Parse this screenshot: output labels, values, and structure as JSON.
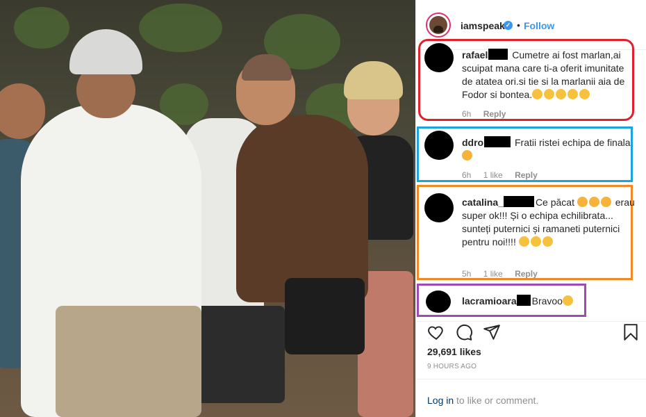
{
  "post": {
    "username": "iamspeak",
    "verified_badge": "✓",
    "separator": "•",
    "follow_label": "Follow"
  },
  "comments": [
    {
      "user": "rafael",
      "text": "Cumetre ai fost marlan,ai scuipat mana care ti-a oferit imunitate de atatea ori.si tie si la marlanii aia de Fodor si bontea.",
      "emoji": "clapping-hands x5",
      "time": "6h",
      "likes": "",
      "reply": "Reply",
      "highlight": "#e0202a"
    },
    {
      "user": "ddro",
      "text": "Fratii ristei echipa de finala",
      "emoji": "sad-face",
      "time": "6h",
      "likes": "1 like",
      "reply": "Reply",
      "highlight": "#1aa3dc"
    },
    {
      "user": "catalina_",
      "text_a": "Ce păcat",
      "text_b": "erau super ok!!! Și o echipa echilibrata... sunteți puternici și ramaneti puternici pentru noi!!!!",
      "emoji": "sad-face x3, hugging-face x3",
      "time": "5h",
      "likes": "1 like",
      "reply": "Reply",
      "highlight": "#f08a26"
    },
    {
      "user": "lacramioara",
      "text": "Bravoo",
      "emoji": "clapping-hands",
      "highlight": "#9b4db5"
    }
  ],
  "actions": {
    "icons": [
      "heart-icon",
      "comment-icon",
      "share-icon",
      "bookmark-icon"
    ]
  },
  "likes_count": "29,691 likes",
  "time_ago": "9 HOURS AGO",
  "login": {
    "link": "Log in",
    "rest": " to like or comment."
  }
}
